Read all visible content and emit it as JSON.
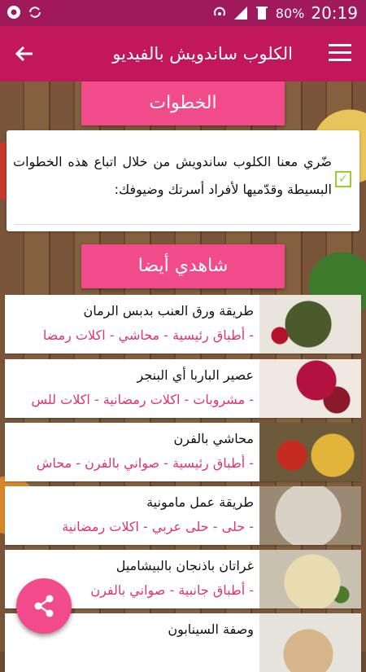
{
  "status": {
    "battery": "80%",
    "time": "20:19"
  },
  "appbar": {
    "title": "الكلوب ساندويش بالفيديو"
  },
  "steps": {
    "header": "الخطوات",
    "text": "ضّري معنا الكلوب ساندويش من خلال اتباع هذه الخطوات البسيطة وقدّميها لأفراد أسرتك وضيوفك:"
  },
  "see_also": {
    "header": "شاهدي أيضا",
    "items": [
      {
        "title": "طريقة ورق العنب بدبس الرمان",
        "categories": "- أطباق رئيسية - محاشي - اكلات رمضا"
      },
      {
        "title": "عصير الباربا أي البنجر",
        "categories": "- مشروبات - اكلات رمضانية - اكلات للس"
      },
      {
        "title": "محاشي بالفرن",
        "categories": "- أطباق رئيسية - صواني بالفرن - محاش"
      },
      {
        "title": "طريقة عمل مامونية",
        "categories": "- حلى - حلى عربي - اكلات رمضانية"
      },
      {
        "title": "غراتان باذنجان بالبيشاميل",
        "categories": "- أطباق جانبية - صواني بالفرن"
      },
      {
        "title": "وصفة السينابون",
        "categories": ""
      }
    ]
  }
}
